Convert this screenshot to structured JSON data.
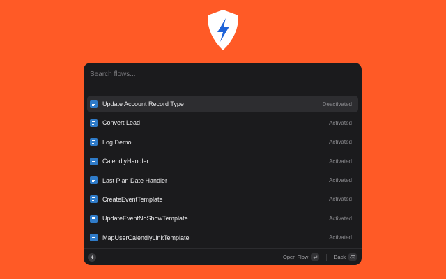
{
  "brand": {
    "accent": "#ff5a26",
    "flow_icon_color": "#2f7bc8",
    "logo_icon": "shield-bolt-icon"
  },
  "search": {
    "placeholder": "Search flows...",
    "value": ""
  },
  "flows": [
    {
      "name": "Update Account Record Type",
      "status": "Deactivated",
      "selected": true
    },
    {
      "name": "Convert Lead",
      "status": "Activated",
      "selected": false
    },
    {
      "name": "Log Demo",
      "status": "Activated",
      "selected": false
    },
    {
      "name": "CalendlyHandler",
      "status": "Activated",
      "selected": false
    },
    {
      "name": "Last Plan Date Handler",
      "status": "Activated",
      "selected": false
    },
    {
      "name": "CreateEventTemplate",
      "status": "Activated",
      "selected": false
    },
    {
      "name": "UpdateEventNoShowTemplate",
      "status": "Activated",
      "selected": false
    },
    {
      "name": "MapUserCalendlyLinkTemplate",
      "status": "Activated",
      "selected": false
    }
  ],
  "footer": {
    "open_label": "Open Flow",
    "open_key_icon": "return-key-icon",
    "back_label": "Back",
    "back_key_icon": "backspace-key-icon"
  }
}
